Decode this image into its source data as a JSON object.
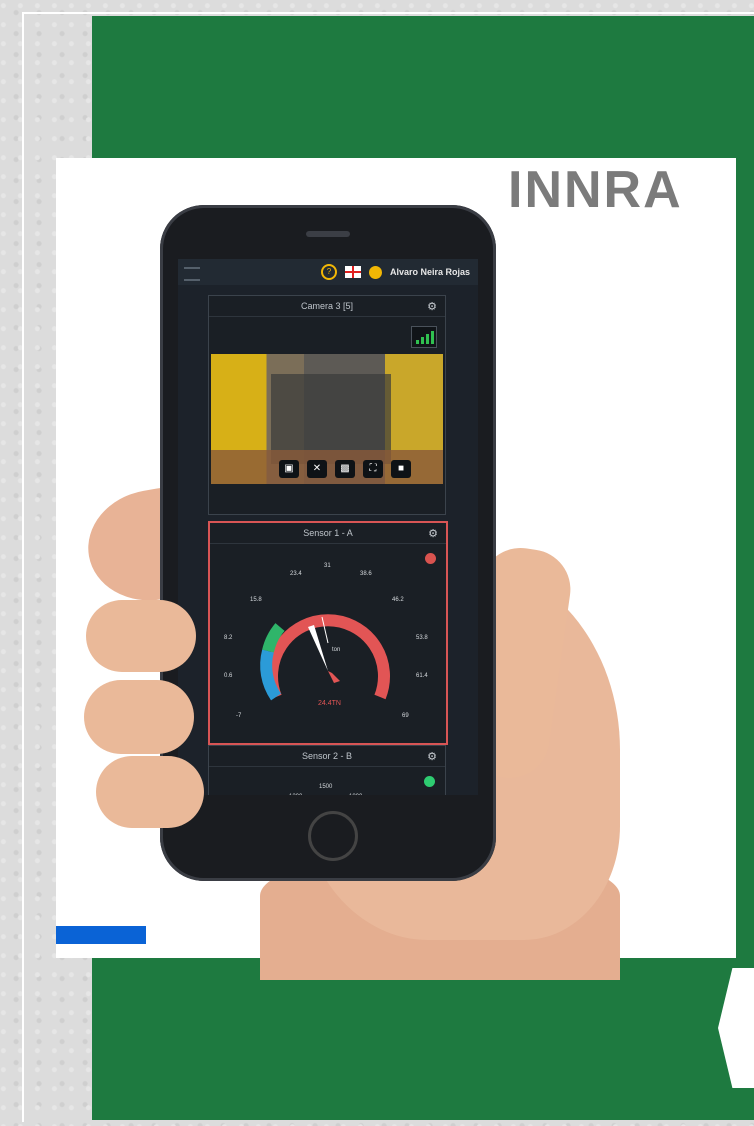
{
  "brand": {
    "name": "INNRA"
  },
  "topbar": {
    "username": "Alvaro Neira Rojas"
  },
  "camera": {
    "title": "Camera 3 [5]"
  },
  "sensor_a": {
    "title": "Sensor 1 - A",
    "value_text": "24.4TN",
    "center_label": "ton",
    "status_color": "#d9534f",
    "ticks": [
      "-7",
      "0.6",
      "8.2",
      "15.8",
      "23.4",
      "31",
      "38.6",
      "46.2",
      "53.8",
      "61.4",
      "69"
    ]
  },
  "sensor_b": {
    "title": "Sensor 2 - B",
    "status_color": "#2ecc71",
    "ticks": [
      "1200",
      "1500",
      "1800"
    ]
  },
  "colors": {
    "green": "#1e7a40",
    "blue": "#0a63d6",
    "alert": "#d85555"
  }
}
